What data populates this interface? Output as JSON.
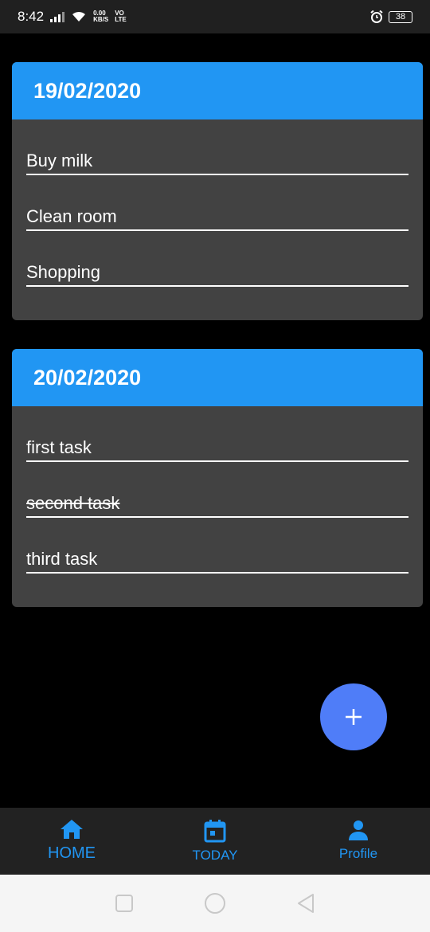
{
  "status_bar": {
    "time": "8:42",
    "net_speed_value": "0.00",
    "net_speed_unit": "KB/S",
    "network_top": "VO",
    "network_bottom": "LTE",
    "battery": "38"
  },
  "cards": [
    {
      "date": "19/02/2020",
      "tasks": [
        {
          "label": "Buy milk",
          "done": false
        },
        {
          "label": "Clean room",
          "done": false
        },
        {
          "label": "Shopping",
          "done": false
        }
      ]
    },
    {
      "date": "20/02/2020",
      "tasks": [
        {
          "label": "first task",
          "done": false
        },
        {
          "label": "second task",
          "done": true
        },
        {
          "label": "third task",
          "done": false
        }
      ]
    }
  ],
  "fab": {
    "icon": "plus-icon"
  },
  "bottom_nav": [
    {
      "label": "HOME",
      "icon": "home-icon"
    },
    {
      "label": "TODAY",
      "icon": "calendar-icon"
    },
    {
      "label": "Profile",
      "icon": "person-icon"
    }
  ],
  "colors": {
    "accent": "#2196f3",
    "card_bg": "#424242",
    "fab": "#4f7df8",
    "background": "#000000"
  }
}
